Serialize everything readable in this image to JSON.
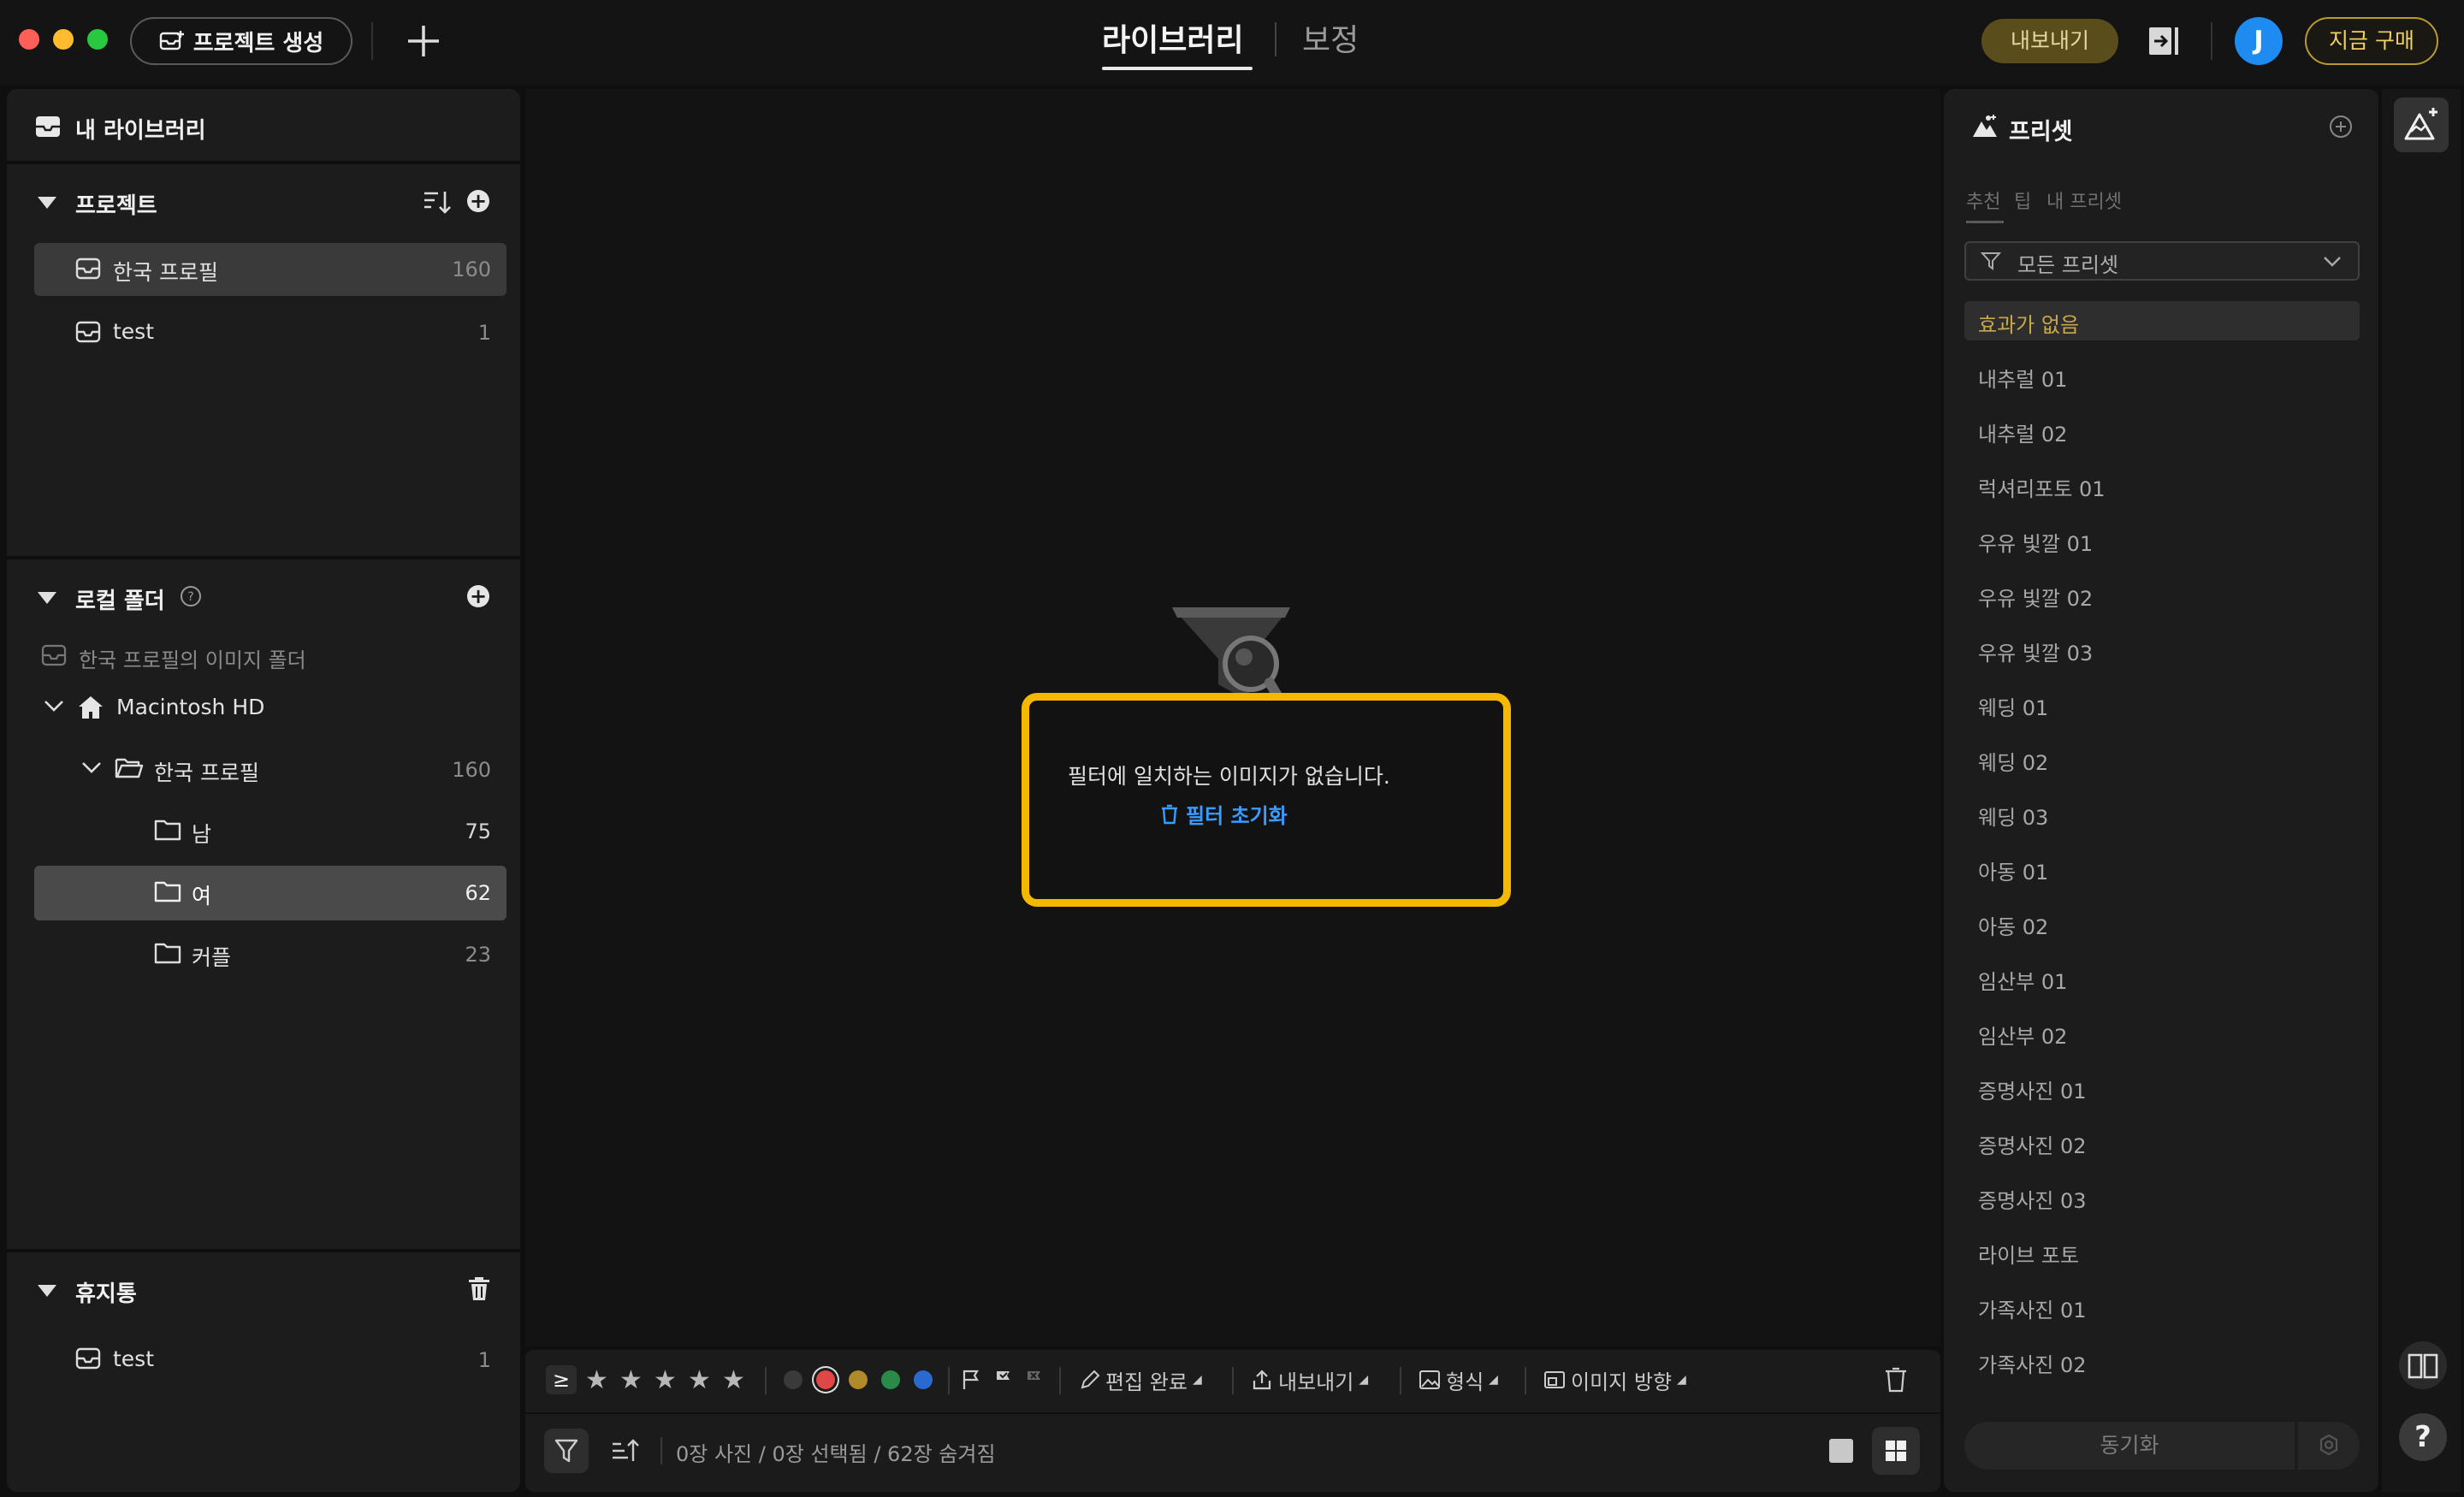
{
  "toolbar": {
    "create_project": "프로젝트 생성",
    "tabs": {
      "library": "라이브러리",
      "edit": "보정"
    },
    "export": "내보내기",
    "avatar_initial": "J",
    "buy_now": "지금 구매"
  },
  "sidebar": {
    "library_title": "내 라이브러리",
    "projects_title": "프로젝트",
    "projects": [
      {
        "label": "한국 프로필",
        "count": "160"
      },
      {
        "label": "test",
        "count": "1"
      }
    ],
    "local_folders_title": "로컬 폴더",
    "image_folder_hint": "한국 프로필의 이미지 폴더",
    "drive": "Macintosh HD",
    "folder": {
      "label": "한국 프로필",
      "count": "160"
    },
    "subfolders": [
      {
        "label": "남",
        "count": "75"
      },
      {
        "label": "여",
        "count": "62"
      },
      {
        "label": "커플",
        "count": "23"
      }
    ],
    "trash_title": "휴지통",
    "trash_items": [
      {
        "label": "test",
        "count": "1"
      }
    ]
  },
  "center": {
    "empty_message": "필터에 일치하는 이미지가 없습니다.",
    "reset_filter": "필터 초기화"
  },
  "bottom_toolbar": {
    "gte_symbol": "≥",
    "color_labels": [
      "#3a3a3a",
      "#e04848",
      "#b08a2a",
      "#2a8a4a",
      "#2a6ad0"
    ],
    "edit_done": "편집 완료",
    "export": "내보내기",
    "format": "형식",
    "orientation": "이미지 방향",
    "status": "0장 사진 / 0장 선택됨 / 62장 숨겨짐"
  },
  "presets": {
    "title": "프리셋",
    "tabs": [
      "추천",
      "팁",
      "내 프리셋"
    ],
    "filter_label": "모든 프리셋",
    "none_label": "효과가 없음",
    "items": [
      "내추럴 01",
      "내추럴 02",
      "럭셔리포토 01",
      "우유 빛깔 01",
      "우유 빛깔 02",
      "우유 빛깔 03",
      "웨딩 01",
      "웨딩 02",
      "웨딩 03",
      "아동 01",
      "아동 02",
      "임산부 01",
      "임산부 02",
      "증명사진 01",
      "증명사진 02",
      "증명사진 03",
      "라이브 포토",
      "가족사진 01",
      "가족사진 02"
    ],
    "sync": "동기화"
  },
  "help_label": "?"
}
